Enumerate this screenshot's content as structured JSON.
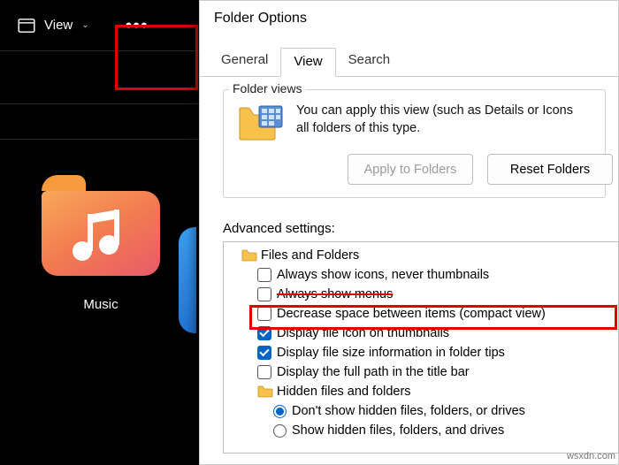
{
  "toolbar": {
    "view_label": "View",
    "more_icon": "more-horizontal-icon"
  },
  "folders": {
    "music_label": "Music"
  },
  "dialog": {
    "title": "Folder Options",
    "tabs": {
      "general": "General",
      "view": "View",
      "search": "Search"
    },
    "folder_views": {
      "legend": "Folder views",
      "text1": "You can apply this view (such as Details or Icons",
      "text2": "all folders of this type.",
      "apply_btn": "Apply to Folders",
      "reset_btn": "Reset Folders"
    },
    "advanced": {
      "label": "Advanced settings:",
      "files_folders": "Files and Folders",
      "opt_icons": "Always show icons, never thumbnails",
      "opt_menus": "Always show menus",
      "opt_compact": "Decrease space between items (compact view)",
      "opt_thumb": "Display file icon on thumbnails",
      "opt_tipsize": "Display file size information in folder tips",
      "opt_fullpath": "Display the full path in the title bar",
      "hidden_folder": "Hidden files and folders",
      "opt_hidden_no": "Don't show hidden files, folders, or drives",
      "opt_hidden_yes": "Show hidden files, folders, and drives"
    }
  },
  "watermark": "wsxdn.com"
}
